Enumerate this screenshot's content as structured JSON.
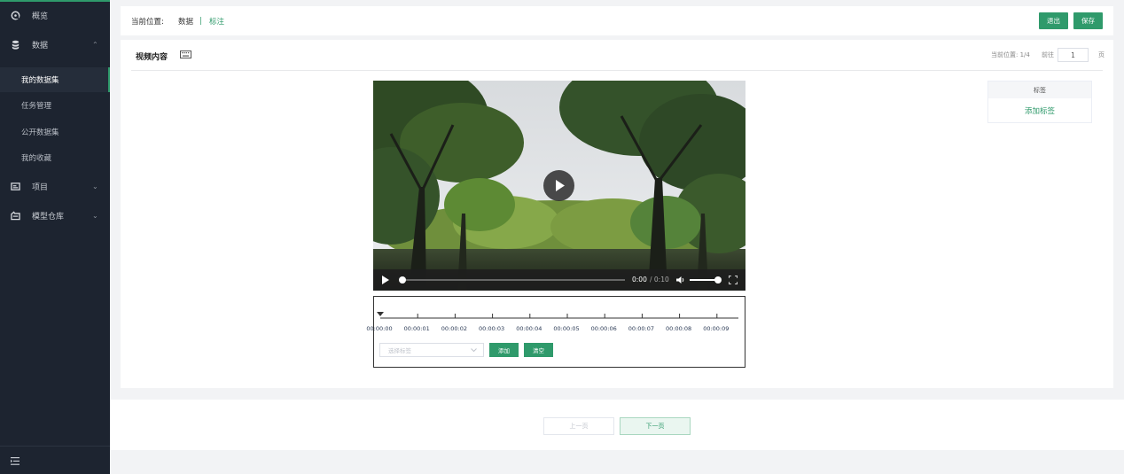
{
  "sidebar": {
    "items": [
      {
        "label": "概览",
        "icon": "dashboard-icon"
      },
      {
        "label": "数据",
        "icon": "database-icon",
        "expanded": true
      },
      {
        "label": "项目",
        "icon": "project-icon"
      },
      {
        "label": "模型仓库",
        "icon": "model-repo-icon"
      }
    ],
    "sub_items": [
      {
        "label": "我的数据集",
        "active": true
      },
      {
        "label": "任务管理"
      },
      {
        "label": "公开数据集"
      },
      {
        "label": "我的收藏"
      }
    ]
  },
  "header": {
    "location_label": "当前位置:",
    "crumb_data": "数据",
    "crumb_sep": "|",
    "crumb_current": "标注",
    "exit_label": "退出",
    "save_label": "保存"
  },
  "main": {
    "title": "视频内容",
    "current_position": "当前位置: 1/4",
    "goto_label": "前往",
    "page_value": "1",
    "page_suffix": "页"
  },
  "video": {
    "current_time": "0:00",
    "duration": "/ 0:10",
    "progress": 0,
    "volume": 1.0
  },
  "timeline": {
    "ticks": [
      "00:00:00",
      "00:00:01",
      "00:00:02",
      "00:00:03",
      "00:00:04",
      "00:00:05",
      "00:00:06",
      "00:00:07",
      "00:00:08",
      "00:00:09"
    ],
    "select_placeholder": "选择标签",
    "add_label": "添加",
    "clear_label": "清空"
  },
  "tags": {
    "header": "标签",
    "add_label": "添加标签"
  },
  "pagination": {
    "prev_label": "上一页",
    "next_label": "下一页"
  },
  "colors": {
    "accent": "#2f9a6b",
    "sidebar_bg": "#1d2430"
  }
}
